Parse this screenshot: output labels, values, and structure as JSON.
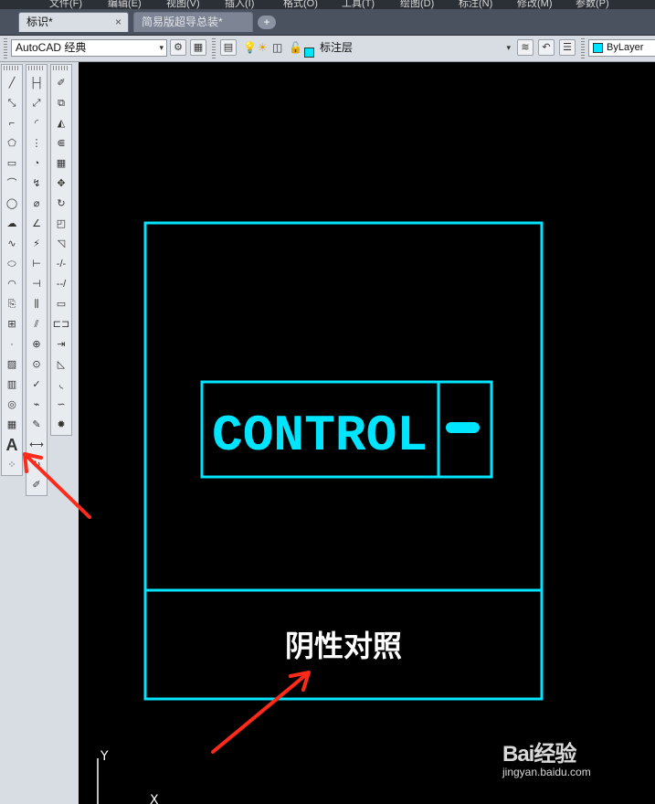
{
  "menu": [
    "文件(F)",
    "编辑(E)",
    "视图(V)",
    "插入(I)",
    "格式(O)",
    "工具(T)",
    "绘图(D)",
    "标注(N)",
    "修改(M)",
    "参数(P)"
  ],
  "tabs": [
    {
      "label": "标识*",
      "close": "×"
    },
    {
      "label": "简易版超导总装*",
      "close": "×"
    }
  ],
  "tab_add": "+",
  "workspace": {
    "value": "AutoCAD 经典",
    "arrow": "▾"
  },
  "layer": {
    "value": "标注层",
    "arrow": "▾"
  },
  "color_control": {
    "value": "ByLayer"
  },
  "drawing": {
    "main_text": "CONTROL",
    "caption": "阴性对照",
    "ucs_y": "Y",
    "ucs_x": "X"
  },
  "palettes": {
    "draw_tools": [
      "line-icon",
      "construction-line-icon",
      "polyline-icon",
      "polygon-icon",
      "rectangle-icon",
      "arc-icon",
      "circle-icon",
      "revision-cloud-icon",
      "spline-icon",
      "ellipse-icon",
      "ellipse-arc-icon",
      "insert-block-icon",
      "make-block-icon",
      "point-icon",
      "hatch-icon",
      "gradient-icon",
      "region-icon",
      "table-icon",
      "multiline-text-icon",
      "add-selected-icon"
    ],
    "dimension_tools": [
      "linear-dim-icon",
      "aligned-dim-icon",
      "arc-length-icon",
      "ordinate-dim-icon",
      "radius-dim-icon",
      "jogged-dim-icon",
      "diameter-dim-icon",
      "angular-dim-icon",
      "quick-dim-icon",
      "baseline-dim-icon",
      "continue-dim-icon",
      "dim-space-icon",
      "dim-break-icon",
      "tolerance-icon",
      "center-mark-icon",
      "inspection-icon",
      "jogged-linear-icon",
      "dim-edit-icon",
      "dim-text-edit-icon",
      "dim-update-icon",
      "dim-style-icon"
    ],
    "modify_tools": [
      "erase-icon",
      "copy-icon",
      "mirror-icon",
      "offset-icon",
      "array-icon",
      "move-icon",
      "rotate-icon",
      "scale-icon",
      "stretch-icon",
      "trim-icon",
      "extend-icon",
      "break-at-point-icon",
      "break-icon",
      "join-icon",
      "chamfer-icon",
      "fillet-icon",
      "blend-curves-icon",
      "explode-icon"
    ]
  },
  "watermark": {
    "brand": "Bai经验",
    "url": "jingyan.baidu.com"
  },
  "colors": {
    "accent": "#00e5ff",
    "annotation_arrow": "#ff2a1a"
  }
}
